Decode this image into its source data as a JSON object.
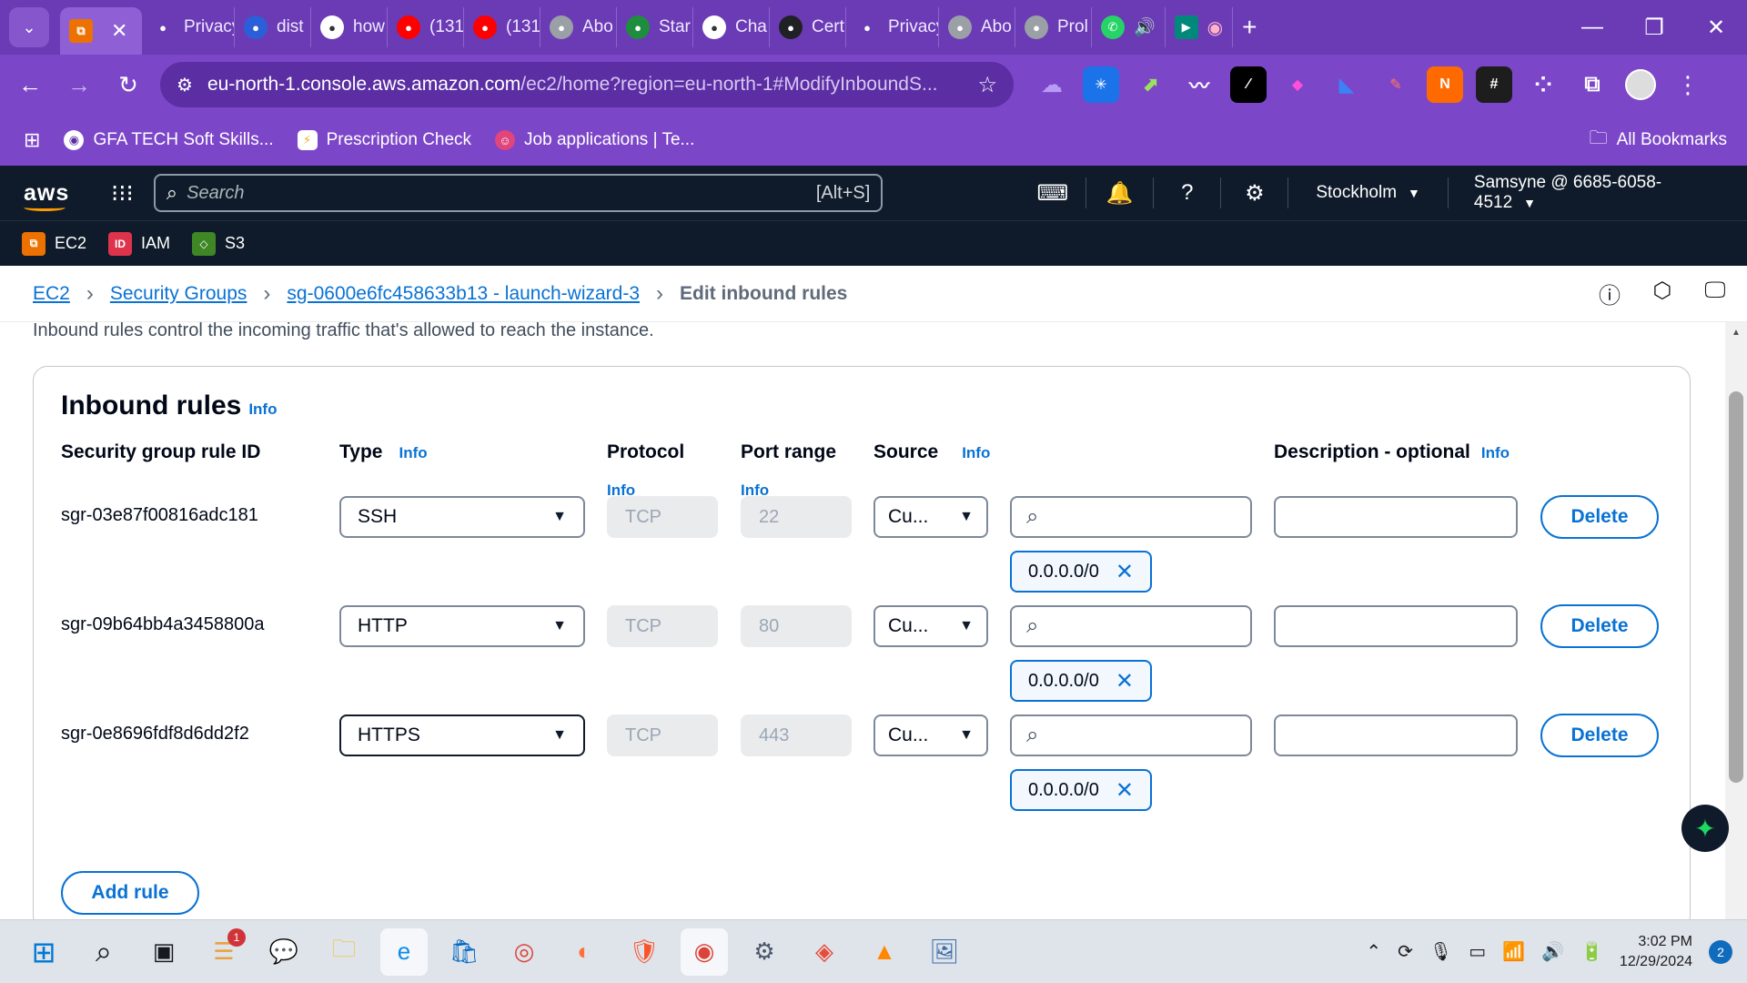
{
  "browser": {
    "tabs": [
      {
        "label": "Privacy e",
        "icon": "privacy-icon",
        "color": "#6a3bb5"
      },
      {
        "label": "dist",
        "icon": "distill-icon",
        "color": "#2b5fd9"
      },
      {
        "label": "how",
        "icon": "google-icon",
        "color": "#ffffff"
      },
      {
        "label": "(131",
        "icon": "youtube-icon",
        "color": "#ff0000"
      },
      {
        "label": "(131",
        "icon": "youtube-icon",
        "color": "#ff0000"
      },
      {
        "label": "Abo",
        "icon": "globe-icon",
        "color": "#9aa0a6"
      },
      {
        "label": "Star",
        "icon": "star-app-icon",
        "color": "#1e8e3e"
      },
      {
        "label": "Cha",
        "icon": "chatgpt-icon",
        "color": "#ffffff"
      },
      {
        "label": "Cert",
        "icon": "cert-icon",
        "color": "#202124"
      },
      {
        "label": "Privacy e",
        "icon": "privacy-icon",
        "color": "#6a3bb5"
      },
      {
        "label": "Abo",
        "icon": "globe-icon",
        "color": "#9aa0a6"
      },
      {
        "label": "Prol",
        "icon": "globe-icon",
        "color": "#9aa0a6"
      }
    ],
    "url_host": "eu-north-1.console.aws.amazon.com",
    "url_rest": "/ec2/home?region=eu-north-1#ModifyInboundS...",
    "bookmarks": [
      "GFA TECH Soft Skills...",
      "Prescription Check",
      "Job applications | Te..."
    ],
    "all_bookmarks": "All Bookmarks"
  },
  "aws": {
    "search_placeholder": "Search",
    "search_shortcut": "[Alt+S]",
    "region": "Stockholm",
    "account": "Samsyne @ 6685-6058-4512",
    "favorites": [
      {
        "label": "EC2",
        "color": "#ed7100"
      },
      {
        "label": "IAM",
        "color": "#dd344c"
      },
      {
        "label": "S3",
        "color": "#3f8624"
      }
    ]
  },
  "breadcrumb": {
    "ec2": "EC2",
    "security_groups": "Security Groups",
    "sg": "sg-0600e6fc458633b13 - launch-wizard-3",
    "current": "Edit inbound rules"
  },
  "intro": "Inbound rules control the incoming traffic that's allowed to reach the instance.",
  "panel": {
    "title": "Inbound rules",
    "info": "Info",
    "headers": {
      "rule_id": "Security group rule ID",
      "type": "Type",
      "protocol": "Protocol",
      "port": "Port range",
      "source": "Source",
      "description": "Description - optional"
    },
    "rules": [
      {
        "id": "sgr-03e87f00816adc181",
        "type": "SSH",
        "protocol": "TCP",
        "port": "22",
        "source": "Cu...",
        "cidr": "0.0.0.0/0"
      },
      {
        "id": "sgr-09b64bb4a3458800a",
        "type": "HTTP",
        "protocol": "TCP",
        "port": "80",
        "source": "Cu...",
        "cidr": "0.0.0.0/0"
      },
      {
        "id": "sgr-0e8696fdf8d6dd2f2",
        "type": "HTTPS",
        "protocol": "TCP",
        "port": "443",
        "source": "Cu...",
        "cidr": "0.0.0.0/0"
      }
    ],
    "delete_label": "Delete",
    "add_rule": "Add rule"
  },
  "taskbar": {
    "time": "3:02 PM",
    "date": "12/29/2024",
    "badge": "1",
    "notifications": "2"
  }
}
